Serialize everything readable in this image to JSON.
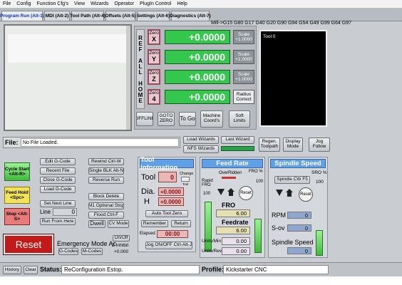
{
  "menu": [
    "File",
    "Config",
    "Function Cfg's",
    "View",
    "Wizards",
    "Operator",
    "PlugIn Control",
    "Help"
  ],
  "tabs": [
    "Program Run (Alt-1)",
    "MDI (Alt-2)",
    "Tool Path (Alt-4)",
    "Offsets (Alt-5)",
    "Settings (Alt-6)",
    "Diagnostics (Alt-7)"
  ],
  "gcode_line": "Mill->G15  G80 G17 G40 G20 G90 G94 G54 G49 G99 G64 G97",
  "ref_all_home": "REF ALL HOME",
  "axes": [
    {
      "label": "Zero",
      "axis": "X",
      "value": "+0.0000",
      "scale_label": "Scale",
      "scale": "+1.0000"
    },
    {
      "label": "Zero",
      "axis": "Y",
      "value": "+0.0000",
      "scale_label": "Scale",
      "scale": "+1.0000"
    },
    {
      "label": "Zero",
      "axis": "Z",
      "value": "+0.0000",
      "scale_label": "Scale",
      "scale": "+1.0000"
    },
    {
      "label": "Zero",
      "axis": "4",
      "value": "+0.0000",
      "scale_label": "Radius",
      "scale": "Correct"
    }
  ],
  "dro_buttons": {
    "offline": "OFFLINE",
    "goto_zero": "GOTO ZERO",
    "to_go": "To Go",
    "machine_coords": "Machine Coord's",
    "soft_limits": "Soft Limits"
  },
  "toolpath": {
    "label": "Tool:0"
  },
  "file": {
    "label": "File:",
    "value": "No File Loaded."
  },
  "wizards": {
    "load": "Load Wizards",
    "last": "Last Wizard",
    "nfs": "NFS Wizards"
  },
  "toolpath_buttons": {
    "regen": "Regen. Toolpath",
    "display": "Display Mode",
    "jog": "Jog Follow"
  },
  "cycle": {
    "start": "Cycle Start <Alt-R>",
    "hold": "Feed Hold <Spc>",
    "stop": "Stop <Alt-S>"
  },
  "prog_buttons": {
    "edit": "Edit G-Code",
    "recent": "Recent File",
    "close": "Close G-Code",
    "load": "Load G-Code",
    "set_next": "Set Next Line",
    "line_label": "Line",
    "line_value": "0",
    "run_from": "Run From Here"
  },
  "run_buttons": {
    "rewind": "Rewind Ctrl-W",
    "single": "Single BLK Alt-N",
    "reverse": "Reverse Run",
    "block_delete": "Block Delete",
    "optional_stop": "M1 Optional Stop",
    "flood": "Flood Ctrl-F",
    "dwell": "Dwell",
    "cv_mode": "CV Mode"
  },
  "tool_info": {
    "header": "Tool Information",
    "tool_label": "Tool",
    "tool_value": "0",
    "change": "Change",
    "tool": "Tool",
    "dia_label": "Dia.",
    "dia_value": "+0.0000",
    "h_label": "H",
    "h_value": "+0.0000",
    "auto_zero": "Auto Tool Zero",
    "remember": "Remember",
    "return": "Return",
    "elapsed_label": "Elapsed",
    "elapsed_value": "00:00",
    "jog": "Jog ON/OFF Ctrl-Alt-J"
  },
  "feed": {
    "header": "Feed Rate",
    "overridden": "OverRidden",
    "fro_pct_label": "FRO %",
    "fro_pct": "100",
    "rapid": "Rapid FRO",
    "rapid_val": "100",
    "reset": "Reset",
    "fro_label": "FRO",
    "fro_value": "6.00",
    "feedrate_label": "Feedrate",
    "feedrate_value": "6.00",
    "units_min_label": "Units/Min",
    "units_min": "0.00",
    "units_rev_label": "Units/Rev",
    "units_rev": "0.00"
  },
  "spindle": {
    "header": "Spindle Speed",
    "cw": "Spindle CW F5",
    "sro_label": "SRO %",
    "sro": "100",
    "reset": "Reset",
    "rpm_label": "RPM",
    "rpm": "0",
    "sov_label": "S-ov",
    "sov": "0",
    "speed_label": "Spindle Speed",
    "speed": "0"
  },
  "bottom": {
    "reset": "Reset",
    "emergency": "Emergency Mode Ac",
    "on_off": "On/Off",
    "z_inhibit": "Z Inhibit",
    "z_value": "+0.000",
    "gcodes": "G-Codes",
    "mcodes": "M-Codes"
  },
  "status": {
    "history": "History",
    "clear": "Clear",
    "label": "Status:",
    "value": "ReConfiguration Estop.",
    "profile_label": "Profile:",
    "profile": "Kickstarter CNC"
  }
}
